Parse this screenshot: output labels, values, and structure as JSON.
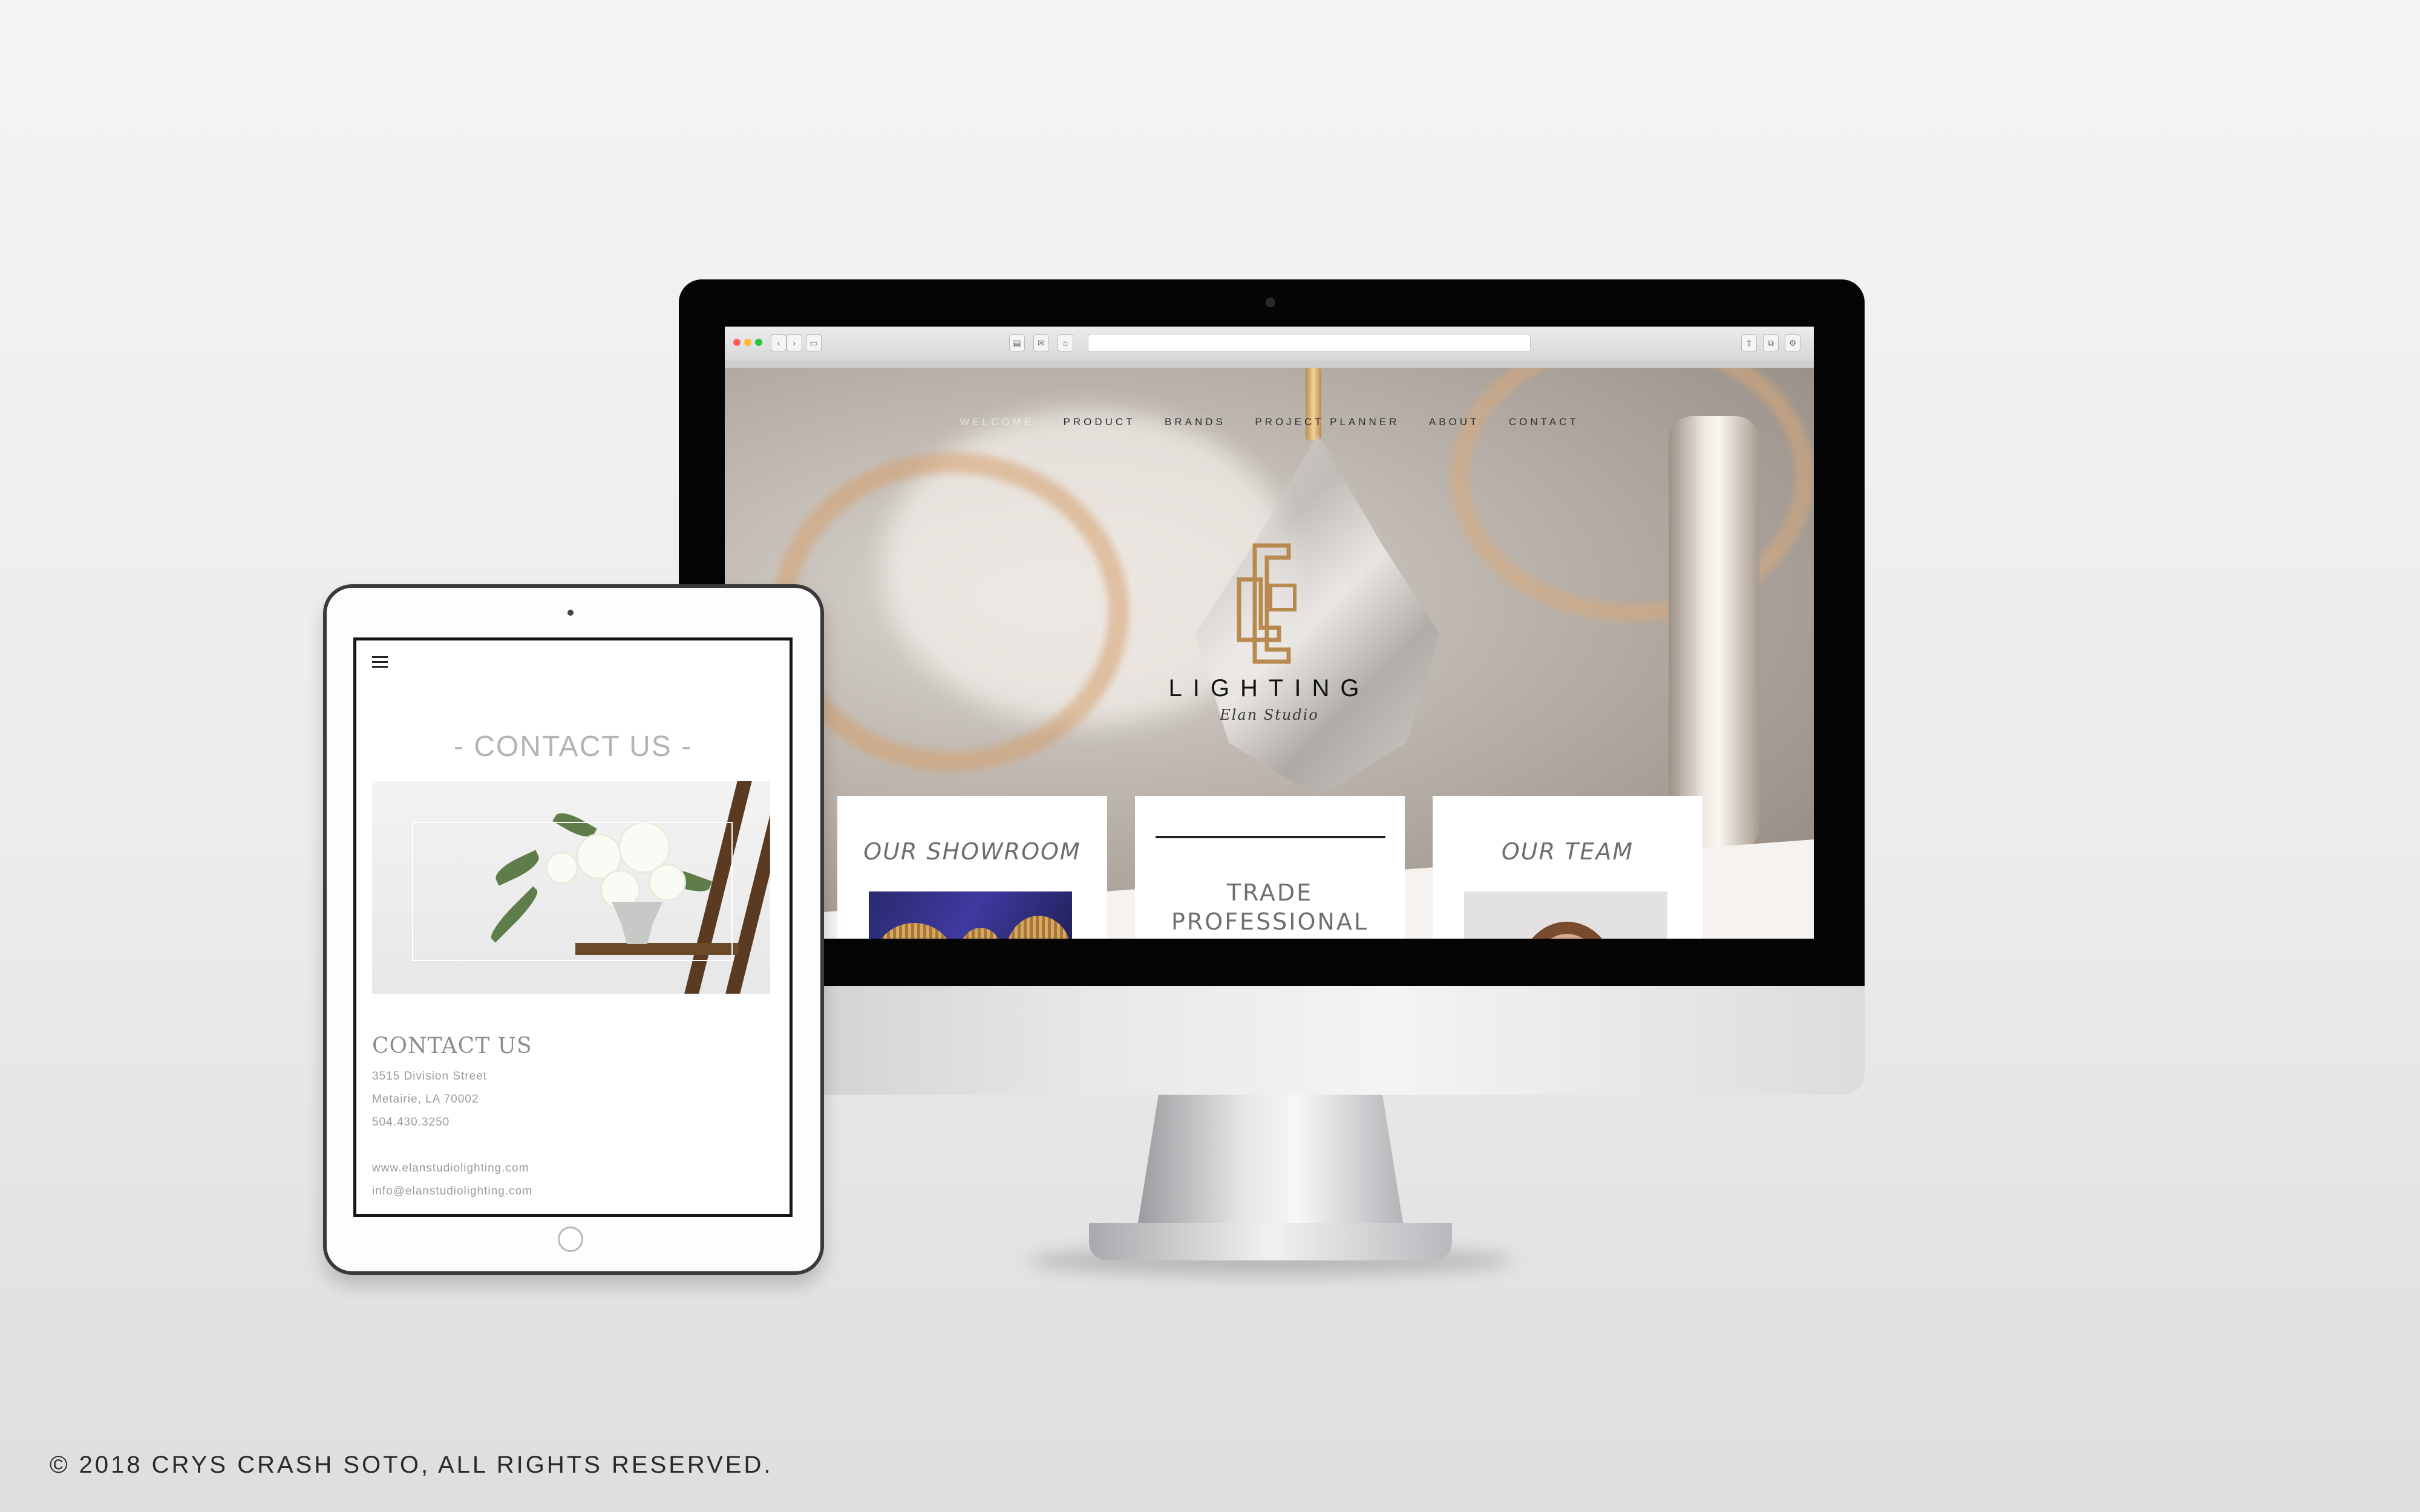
{
  "desktop": {
    "menu": [
      "WELCOME",
      "PRODUCT",
      "BRANDS",
      "PROJECT PLANNER",
      "ABOUT",
      "CONTACT"
    ],
    "logo": {
      "word": "LIGHTING",
      "script": "Elan Studio"
    },
    "cards": {
      "showroom": "OUR SHOWROOM",
      "trade_line1": "TRADE",
      "trade_line2": "PROFESSIONAL",
      "team": "OUR TEAM"
    }
  },
  "tablet": {
    "heading": "- CONTACT US -",
    "subheading": "CONTACT US",
    "address1": "3515 Division Street",
    "address2": "Metairie, LA 70002",
    "phone": "504.430.3250",
    "website": "www.elanstudiolighting.com",
    "email": "info@elanstudiolighting.com"
  },
  "footer": {
    "copyright": "© 2018 CRYS CRASH SOTO, ALL RIGHTS RESERVED."
  },
  "colors": {
    "accent_gold": "#b98a4f",
    "text_gray": "#6e6e6e"
  }
}
